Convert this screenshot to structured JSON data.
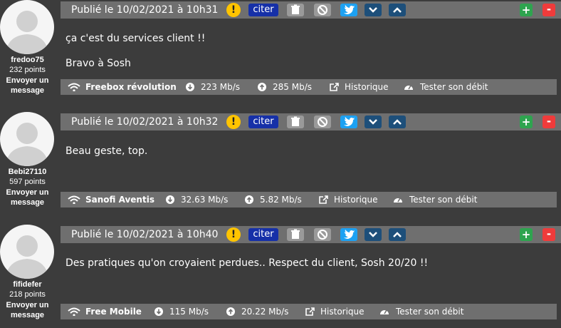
{
  "labels": {
    "citer": "citer",
    "warn": "!",
    "plus": "+",
    "minus": "-",
    "historique": "Historique",
    "tester": "Tester son débit",
    "envoyer": "Envoyer un message"
  },
  "colors": {
    "background": "#3c3c3c",
    "bar": "#6f6f6f",
    "citer": "#1630a8",
    "warn": "#ffc400",
    "twitter": "#1da1f2",
    "vote_up": "#2ea44f",
    "vote_down": "#ef3b3b"
  },
  "posts": [
    {
      "user": {
        "name": "fredoo75",
        "points": "232 points"
      },
      "date": "Publié le 10/02/2021 à 10h31",
      "lines": [
        "ça c'est du services client !!",
        "Bravo à Sosh"
      ],
      "connection": {
        "name": "Freebox révolution",
        "down": "223 Mb/s",
        "up": "285 Mb/s"
      }
    },
    {
      "user": {
        "name": "Bebi27110",
        "points": "597 points"
      },
      "date": "Publié le 10/02/2021 à 10h32",
      "lines": [
        "Beau geste, top."
      ],
      "connection": {
        "name": "Sanofi Aventis",
        "down": "32.63 Mb/s",
        "up": "5.82 Mb/s"
      }
    },
    {
      "user": {
        "name": "fifidefer",
        "points": "218 points"
      },
      "date": "Publié le 10/02/2021 à 10h40",
      "lines": [
        "Des pratiques qu'on croyaient perdues.. Respect du client, Sosh 20/20 !!"
      ],
      "connection": {
        "name": "Free Mobile",
        "down": "115 Mb/s",
        "up": "20.22 Mb/s"
      }
    }
  ]
}
